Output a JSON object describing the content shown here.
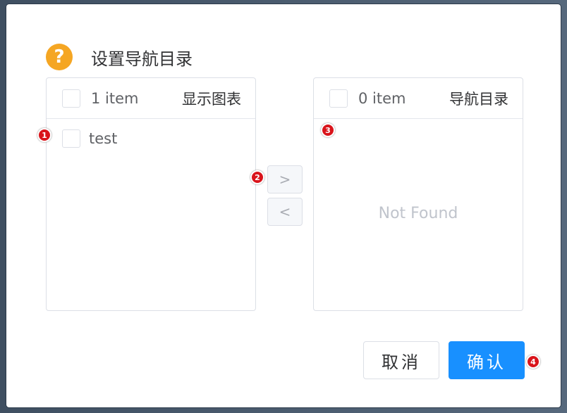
{
  "dialog": {
    "title": "设置导航目录",
    "help_icon": "question-icon"
  },
  "left_panel": {
    "count": "1 item",
    "title": "显示图表",
    "items": [
      {
        "label": "test",
        "checked": false
      }
    ]
  },
  "right_panel": {
    "count": "0 item",
    "title": "导航目录",
    "empty_text": "Not Found"
  },
  "transfer": {
    "to_right": ">",
    "to_left": "<"
  },
  "footer": {
    "cancel_label": "取消",
    "confirm_label": "确认"
  },
  "markers": [
    "1",
    "2",
    "3",
    "4"
  ],
  "colors": {
    "primary": "#1890ff",
    "help": "#f5a623",
    "marker": "#d9141b"
  }
}
